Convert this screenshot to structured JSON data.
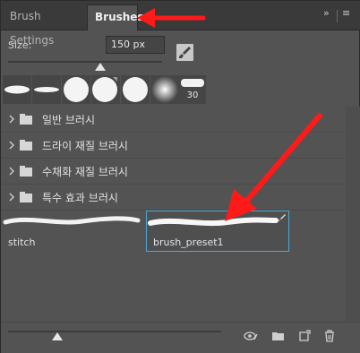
{
  "tabs": [
    {
      "label": "Brush Settings"
    },
    {
      "label": "Brushes"
    }
  ],
  "size": {
    "label": "Size:",
    "value": "150 px",
    "slider_fraction": 0.6
  },
  "recent_tip_number": "30",
  "groups": [
    {
      "label": "일반 브러시"
    },
    {
      "label": "드라이 재질 브러시"
    },
    {
      "label": "수채화 재질 브러시"
    },
    {
      "label": "특수 효과 브러시"
    }
  ],
  "presets": [
    {
      "label": "stitch"
    },
    {
      "label": "brush_preset1"
    }
  ],
  "preview_slider_fraction": 0.24,
  "icons": [
    "panel-menu-icon",
    "collapse-icon",
    "new-brush-icon",
    "eye-brush-icon",
    "folder-icon",
    "new-preset-icon",
    "trash-icon"
  ],
  "colors": {
    "selection": "#4ba8d8",
    "annotation_arrow": "#ff1a1a"
  }
}
